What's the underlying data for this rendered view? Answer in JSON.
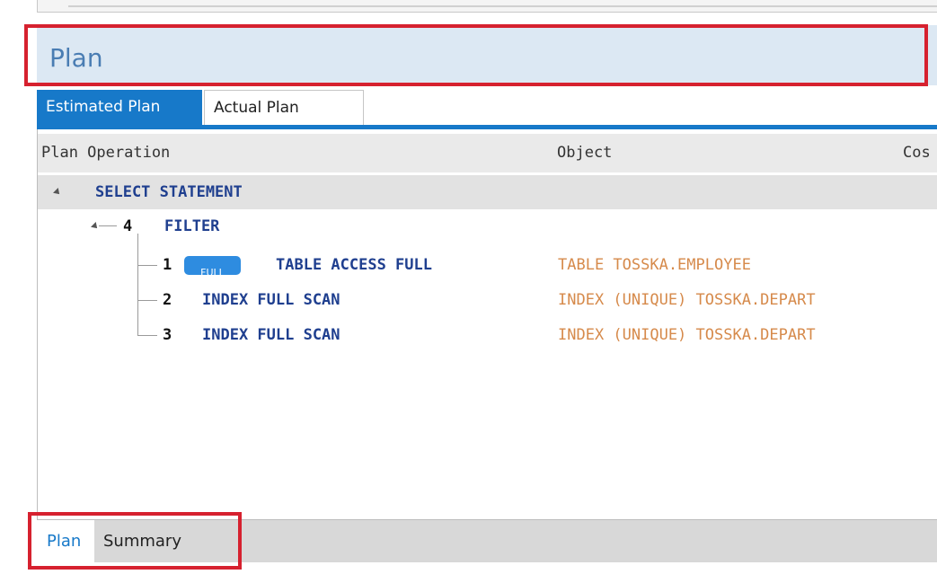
{
  "header": {
    "title": "Plan"
  },
  "plan_tabs": [
    {
      "label": "Estimated Plan",
      "active": true
    },
    {
      "label": "Actual Plan",
      "active": false
    }
  ],
  "columns": [
    "Plan Operation",
    "Object",
    "Cos"
  ],
  "rows": [
    {
      "id": "",
      "operation": "SELECT STATEMENT",
      "object": "",
      "badge": ""
    },
    {
      "id": "4",
      "operation": "FILTER",
      "object": "",
      "badge": ""
    },
    {
      "id": "1",
      "operation": "TABLE ACCESS FULL",
      "object": "TABLE TOSSKA.EMPLOYEE",
      "badge": "FULL"
    },
    {
      "id": "2",
      "operation": "INDEX FULL SCAN",
      "object": "INDEX (UNIQUE) TOSSKA.DEPART",
      "badge": ""
    },
    {
      "id": "3",
      "operation": "INDEX FULL SCAN",
      "object": "INDEX (UNIQUE) TOSSKA.DEPART",
      "badge": ""
    }
  ],
  "bottom_tabs": [
    {
      "label": "Plan",
      "active": true
    },
    {
      "label": "Summary",
      "active": false
    }
  ],
  "colors": {
    "accent": "#1779c9",
    "highlight_box": "#d6212f",
    "operation_text": "#1f3f8f",
    "object_text": "#d68a4b",
    "badge": "#2e8ce0"
  }
}
